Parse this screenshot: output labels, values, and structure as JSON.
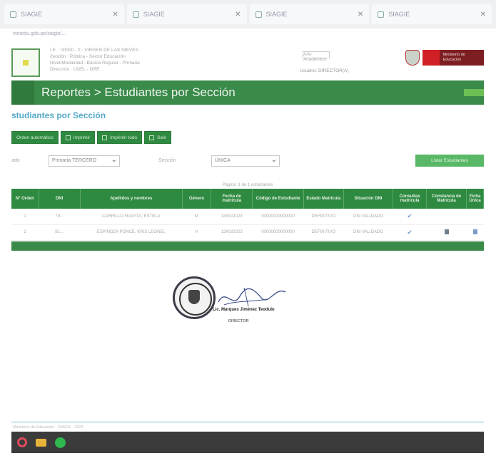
{
  "browser": {
    "tabs": [
      {
        "label": "SIAGIE"
      },
      {
        "label": "SIAGIE"
      },
      {
        "label": "SIAGIE"
      },
      {
        "label": "SIAGIE"
      }
    ],
    "address": "minedu.gob.pe/siagie/..."
  },
  "header": {
    "institution_lines": [
      "I.E. : 00000 - 0 - VIRGEN DE LAS NIEVES",
      "Gestión : Pública - Sector Educación",
      "Nivel/Modalidad : Básica Regular - Primaria",
      "Dirección : UGEL - DRE"
    ],
    "year_label": "Año Académico",
    "user": "Usuario: DIRECTOR(A)",
    "ministry_label": "Ministerio de Educación"
  },
  "title": "Reportes > Estudiantes por Sección",
  "section_title": "studiantes por Sección",
  "toolbar": {
    "order": "Orden automático",
    "print": "Imprimir",
    "print_all": "Imprimir todo",
    "exit": "Salir"
  },
  "filters": {
    "grade_label": "ado",
    "grade_value": "Primaria TERCERO",
    "section_label": "Sección",
    "section_value": "ÚNICA",
    "list_button": "Listar Estudiantes"
  },
  "table": {
    "caption": "Página: 1 de 1 estudiantes",
    "headers": [
      "N° Orden",
      "DNI",
      "Apellidos y nombres",
      "Género",
      "Fecha de matrícula",
      "Código de Estudiante",
      "Estado Matrícula",
      "Situación DNI",
      "Consultas matrícula",
      "Constancia de Matrícula",
      "Ficha Única"
    ],
    "rows": [
      {
        "n": "1",
        "dni": "79... ",
        "name": "CARRILLO HUAYTA, ESTELA",
        "gender": "M",
        "date": "13/03/2023",
        "code": "00000000000000",
        "status": "DEFINITIVO",
        "dni_status": "DNI VALIDADO"
      },
      {
        "n": "2",
        "dni": "81...",
        "name": "ESPINOZA PONCE, KRIS LEONEL",
        "gender": "H",
        "date": "13/03/2023",
        "code": "00000000000000",
        "status": "DEFINITIVO",
        "dni_status": "DNI VALIDADO"
      }
    ]
  },
  "signature": {
    "name": "Lic. Marques Jiménez Teodulo",
    "role": "DIRECTOR"
  },
  "status_text": "Ministerio de Educación - SIAGIE - 2023",
  "colors": {
    "primary_green": "#2e8a40",
    "accent_blue": "#53a8c8"
  }
}
